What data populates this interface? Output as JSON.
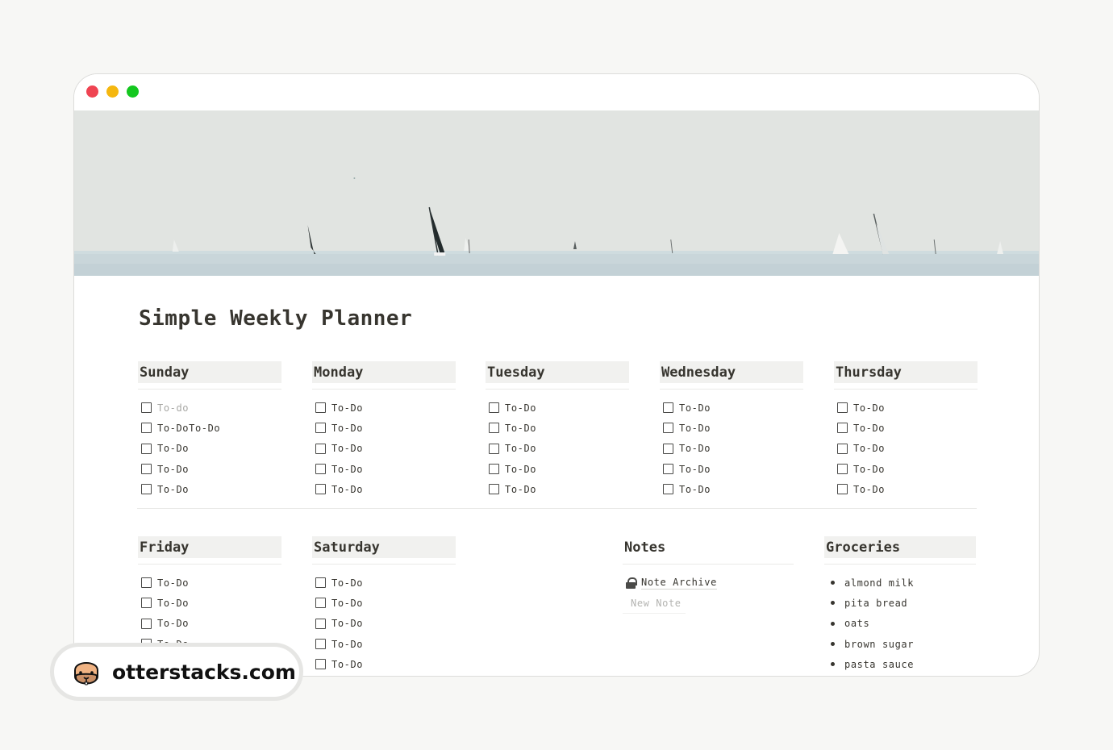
{
  "window": {
    "controls": [
      "close",
      "minimize",
      "maximize"
    ]
  },
  "cover": {
    "description": "Sailboats on hazy sea"
  },
  "page": {
    "title": "Simple Weekly Planner"
  },
  "days": [
    {
      "name": "Sunday",
      "items": [
        "To-do",
        "To-DoTo-Do",
        "To-Do",
        "To-Do",
        "To-Do"
      ]
    },
    {
      "name": "Monday",
      "items": [
        "To-Do",
        "To-Do",
        "To-Do",
        "To-Do",
        "To-Do"
      ]
    },
    {
      "name": "Tuesday",
      "items": [
        "To-Do",
        "To-Do",
        "To-Do",
        "To-Do",
        "To-Do"
      ]
    },
    {
      "name": "Wednesday",
      "items": [
        "To-Do",
        "To-Do",
        "To-Do",
        "To-Do",
        "To-Do"
      ]
    },
    {
      "name": "Thursday",
      "items": [
        "To-Do",
        "To-Do",
        "To-Do",
        "To-Do",
        "To-Do"
      ]
    },
    {
      "name": "Friday",
      "items": [
        "To-Do",
        "To-Do",
        "To-Do",
        "To-Do"
      ]
    },
    {
      "name": "Saturday",
      "items": [
        "To-Do",
        "To-Do",
        "To-Do",
        "To-Do",
        "To-Do"
      ]
    }
  ],
  "notes": {
    "title": "Notes",
    "archive_link": "Note Archive",
    "new_note": "New Note"
  },
  "groceries": {
    "title": "Groceries",
    "items": [
      "almond milk",
      "pita bread",
      "oats",
      "brown sugar",
      "pasta sauce"
    ]
  },
  "badge": {
    "text": "otterstacks.com"
  },
  "colors": {
    "close": "#ef4452",
    "minimize": "#f5b70f",
    "maximize": "#14c71f",
    "header_bg": "#f1f1ef",
    "text": "#37352f"
  }
}
